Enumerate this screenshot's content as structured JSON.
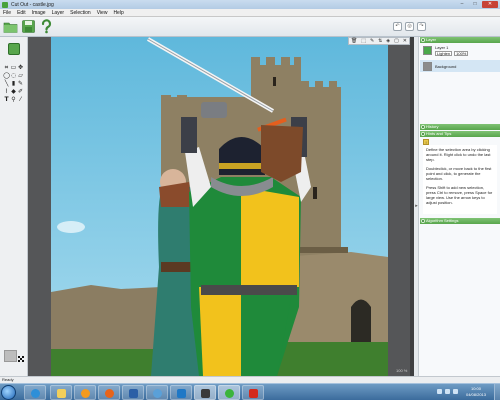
{
  "window": {
    "title": "Cut Out - castle.jpg"
  },
  "menu": [
    "File",
    "Edit",
    "Image",
    "Layer",
    "Selection",
    "View",
    "Help"
  ],
  "layers_panel": {
    "title": "Layer",
    "layer1_name": "Layer 1",
    "layer1_blend": "Lighten",
    "layer1_opacity": "100%",
    "background_name": "Background"
  },
  "history_panel": {
    "title": "History"
  },
  "hints_panel": {
    "title": "Hints and Tips",
    "paragraphs": [
      "Define the selection area by clicking around it. Right click to undo the last step.",
      "Doubleclick, or move back to the first point and click, to generate the selection.",
      "Press Shift to add new selection, press Ctrl to remove, press Space for large view. Use the arrow keys to adjust position."
    ]
  },
  "algorithm_panel": {
    "title": "Algorithm Settings"
  },
  "status": {
    "text": "Ready"
  },
  "canvas": {
    "zoom": "100 %"
  },
  "clock": {
    "time": "10:00",
    "date": "04/08/2013"
  },
  "colors": {
    "accent": "#58a64c",
    "canvas_bg": "#555658"
  }
}
